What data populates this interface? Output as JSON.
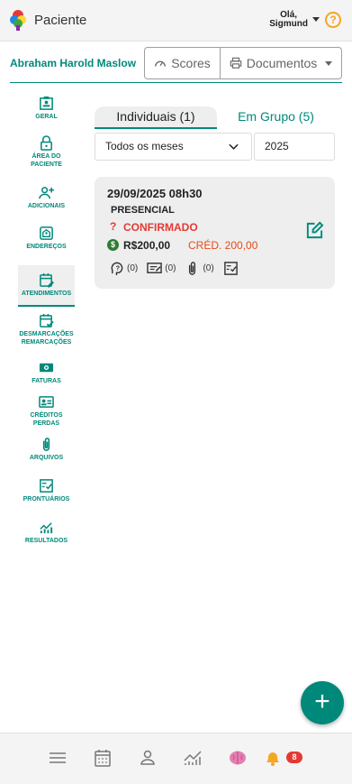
{
  "header": {
    "title": "Paciente",
    "greeting_line1": "Olá,",
    "greeting_line2": "Sigmund",
    "help_glyph": "?"
  },
  "patient": {
    "name": "Abraham Harold Maslow",
    "scores_label": "Scores",
    "documents_label": "Documentos"
  },
  "sidebar": {
    "items": [
      {
        "label": "GERAL",
        "icon": "id-card-icon"
      },
      {
        "label": "ÁREA DO PACIENTE",
        "icon": "lock-icon"
      },
      {
        "label": "ADICIONAIS",
        "icon": "user-add-icon"
      },
      {
        "label": "ENDEREÇOS",
        "icon": "address-icon"
      },
      {
        "label": "ATENDIMENTOS",
        "icon": "calendar-edit-icon",
        "active": true
      },
      {
        "label": "DESMARCAÇÕES REMARCAÇÕES",
        "icon": "calendar-check-icon"
      },
      {
        "label": "FATURAS",
        "icon": "money-icon"
      },
      {
        "label": "CRÉDITOS PERDAS",
        "icon": "credit-card-icon"
      },
      {
        "label": "ARQUIVOS",
        "icon": "paperclip-icon"
      },
      {
        "label": "PRONTUÁRIOS",
        "icon": "checklist-icon"
      },
      {
        "label": "RESULTADOS",
        "icon": "chart-icon"
      }
    ]
  },
  "tabs": {
    "individual": "Individuais (1)",
    "group": "Em Grupo (5)"
  },
  "filters": {
    "month": "Todos os meses",
    "year": "2025"
  },
  "appointment": {
    "datetime": "29/09/2025 08h30",
    "type": "PRESENCIAL",
    "status_glyph": "?",
    "status": "CONFIRMADO",
    "value": "R$200,00",
    "credit": "CRÉD. 200,00",
    "money_glyph": "$",
    "questions_count": "(0)",
    "notes_count": "(0)",
    "attachments_count": "(0)"
  },
  "fab": {
    "glyph": "+"
  },
  "bottom_nav": {
    "notification_count": "8"
  },
  "colors": {
    "accent": "#00897b",
    "status": "#e53935",
    "credit": "#e64a19",
    "help": "#f5a623"
  }
}
